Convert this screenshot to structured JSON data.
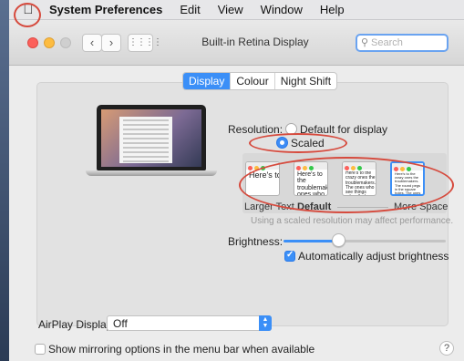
{
  "menubar": {
    "apple_icon": "apple-logo",
    "items": [
      {
        "label": "System Preferences",
        "bold": true
      },
      {
        "label": "Edit",
        "bold": false
      },
      {
        "label": "View",
        "bold": false
      },
      {
        "label": "Window",
        "bold": false
      },
      {
        "label": "Help",
        "bold": false
      }
    ]
  },
  "toolbar": {
    "title": "Built-in Retina Display",
    "back_icon": "chevron-left-icon",
    "forward_icon": "chevron-right-icon",
    "grid_icon": "grid-icon",
    "search_placeholder": "Search",
    "search_icon": "magnifier-icon"
  },
  "tabs": [
    {
      "label": "Display",
      "active": true
    },
    {
      "label": "Colour",
      "active": false
    },
    {
      "label": "Night Shift",
      "active": false
    }
  ],
  "resolution": {
    "label": "Resolution:",
    "options": [
      {
        "label": "Default for display",
        "selected": false
      },
      {
        "label": "Scaled",
        "selected": true
      }
    ]
  },
  "scaling": {
    "options": [
      {
        "sample": "Here's to the troublemakers",
        "selected": false
      },
      {
        "sample": "Here's to the troublemakers ones who",
        "selected": false
      },
      {
        "sample": "Here's to the crazy ones the troublemakers. The ones who see things rules. And they",
        "selected": false
      },
      {
        "sample": "Here's to the crazy ones the troublemakers. The round pegs in the square holes. The ones who see things differently. They're not fond of rules. And they have no respect for the status quo.",
        "selected": true
      }
    ],
    "labels": {
      "larger": "Larger Text",
      "default": "Default",
      "more": "More Space"
    },
    "warning": "Using a scaled resolution may affect performance."
  },
  "brightness": {
    "label": "Brightness:",
    "level": 0.34,
    "auto_label": "Automatically adjust brightness",
    "auto_checked": true
  },
  "airplay": {
    "label": "AirPlay Display:",
    "value": "Off"
  },
  "mirroring": {
    "label": "Show mirroring options in the menu bar when available",
    "checked": false
  },
  "help_label": "?",
  "colors": {
    "accent": "#3b8ff7",
    "annotation": "#d64a3d",
    "traffic_close": "#fc605b",
    "traffic_min": "#fdbc40"
  }
}
